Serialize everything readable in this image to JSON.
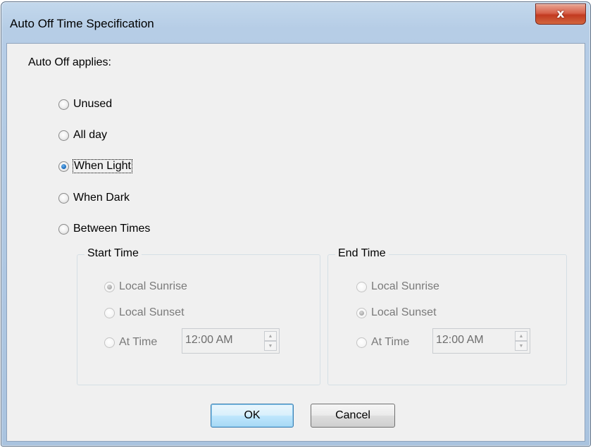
{
  "window": {
    "title": "Auto Off Time Specification",
    "close_glyph": "x"
  },
  "form": {
    "prompt": "Auto Off applies:",
    "options": [
      {
        "label": "Unused",
        "checked": false
      },
      {
        "label": "All day",
        "checked": false
      },
      {
        "label": "When Light",
        "checked": true
      },
      {
        "label": "When Dark",
        "checked": false
      },
      {
        "label": "Between Times",
        "checked": false
      }
    ]
  },
  "start_time": {
    "title": "Start Time",
    "options": [
      {
        "label": "Local Sunrise",
        "checked": true
      },
      {
        "label": "Local Sunset",
        "checked": false
      },
      {
        "label": "At Time",
        "checked": false
      }
    ],
    "time_value": "12:00 AM"
  },
  "end_time": {
    "title": "End Time",
    "options": [
      {
        "label": "Local Sunrise",
        "checked": false
      },
      {
        "label": "Local Sunset",
        "checked": true
      },
      {
        "label": "At Time",
        "checked": false
      }
    ],
    "time_value": "12:00 AM"
  },
  "buttons": {
    "ok": "OK",
    "cancel": "Cancel"
  },
  "spinner": {
    "up_glyph": "▲",
    "down_glyph": "▼"
  },
  "colors": {
    "title_bar": "#b6cde6",
    "close_button": "#c23a20",
    "client_bg": "#f0f0f0",
    "selected_radio": "#1e6fc0"
  }
}
